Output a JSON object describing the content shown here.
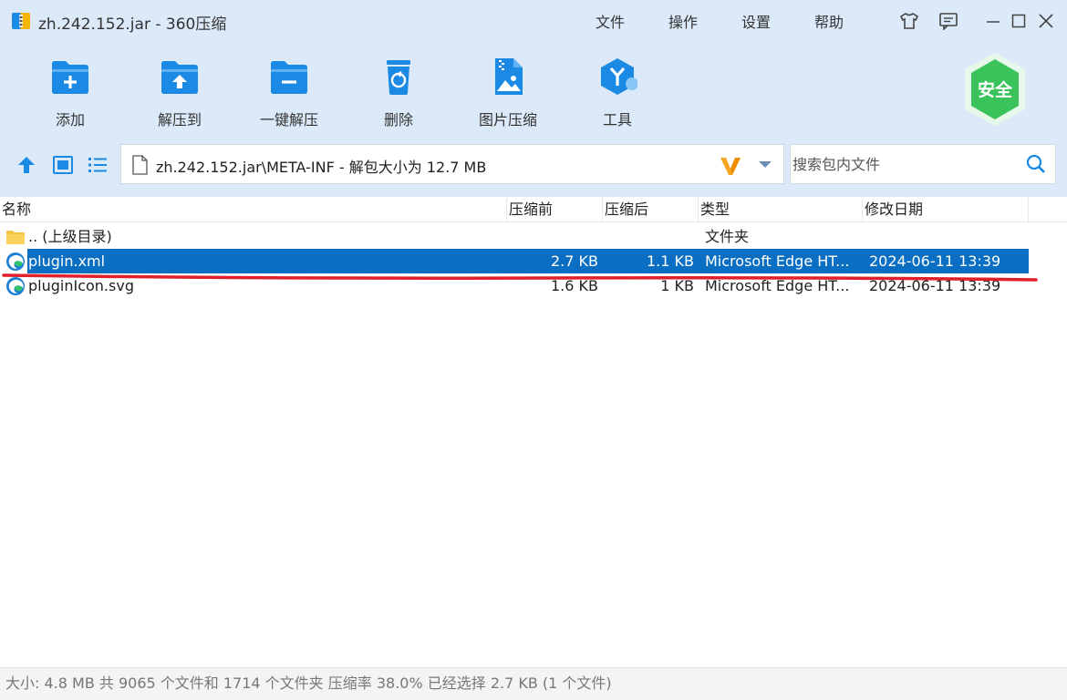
{
  "window": {
    "title": "zh.242.152.jar - 360压缩",
    "menus": [
      "文件",
      "操作",
      "设置",
      "帮助"
    ]
  },
  "toolbar": {
    "buttons": [
      {
        "label": "添加",
        "icon": "add-folder-icon"
      },
      {
        "label": "解压到",
        "icon": "extract-to-icon"
      },
      {
        "label": "一键解压",
        "icon": "one-click-extract-icon"
      },
      {
        "label": "删除",
        "icon": "delete-icon"
      },
      {
        "label": "图片压缩",
        "icon": "image-compress-icon"
      },
      {
        "label": "工具",
        "icon": "tools-icon"
      }
    ],
    "security_badge": "安全"
  },
  "navigation": {
    "path": "zh.242.152.jar\\META-INF - 解包大小为 12.7 MB",
    "search_placeholder": "搜索包内文件"
  },
  "file_list": {
    "columns": [
      "名称",
      "压缩前",
      "压缩后",
      "类型",
      "修改日期"
    ],
    "rows": [
      {
        "name": ".. (上级目录)",
        "size": "",
        "packed": "",
        "type": "文件夹",
        "modified": "",
        "icon": "folder-icon"
      },
      {
        "name": "plugin.xml",
        "size": "2.7 KB",
        "packed": "1.1 KB",
        "type": "Microsoft Edge HT...",
        "modified": "2024-06-11 13:39",
        "icon": "edge-file-icon",
        "selected": true
      },
      {
        "name": "pluginIcon.svg",
        "size": "1.6 KB",
        "packed": "1 KB",
        "type": "Microsoft Edge HT...",
        "modified": "2024-06-11 13:39",
        "icon": "edge-file-icon"
      }
    ]
  },
  "status_bar": {
    "text": "大小: 4.8 MB 共 9065 个文件和 1714 个文件夹 压缩率 38.0% 已经选择 2.7 KB (1 个文件)"
  },
  "colors": {
    "header_bg": "#dbe9f9",
    "icon_blue": "#1a8ae5",
    "selection": "#0a6fc2",
    "badge_green": "#39c35a",
    "annotation_red": "#e0202a"
  }
}
